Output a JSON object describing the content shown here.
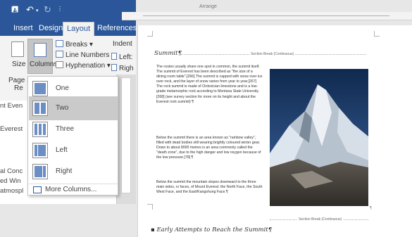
{
  "qat": {
    "save_icon": "save-icon",
    "undo_icon": "undo-icon",
    "redo_icon": "redo-icon",
    "customize_icon": "customize-qat-icon"
  },
  "tabs": [
    {
      "label": "Insert",
      "active": false
    },
    {
      "label": "Design",
      "active": false
    },
    {
      "label": "Layout",
      "active": true
    },
    {
      "label": "References",
      "active": false
    }
  ],
  "ribbon": {
    "breaks": "Breaks",
    "line_numbers": "Line Numbers",
    "hyphenation": "Hyphenation",
    "indent": "Indent",
    "left": "Left:",
    "right": "Righ",
    "size": "Size",
    "columns": "Columns",
    "page_setup_cut": "Page S",
    "page_setup_cut2": "Re"
  },
  "columns_menu": {
    "items": [
      {
        "label": "One"
      },
      {
        "label": "Two",
        "selected": true
      },
      {
        "label": "Three"
      },
      {
        "label": "Left"
      },
      {
        "label": "Right"
      }
    ],
    "more": "More Columns..."
  },
  "background_text": [
    "nt Even",
    "Everest",
    "al Conc",
    "ed Win",
    "atmospl"
  ],
  "document": {
    "toolbar_label": "Arrange",
    "heading1": "Summit¶",
    "section_break": "Section Break (Continuous)",
    "para1": "The routes usually share one spot in common, the summit itself. The summit of Everest has been described as \"the size of a dining room table\".[266] The summit is capped with snow over ice over rock, and the layer of snow varies from year to year.[267] The rock summit is made of Ordovician limestone and is a low-grade metamorphic rock according to Montana State University.[268] (see survey section for more on its height and about the Everest rock summit) ¶",
    "para2": "Below the summit there is an area known as \"rainbow valley\", filled with dead bodies still wearing brightly coloured winter gear. Down to about 8000 metres is an area commonly called the \"death zone\", due to the high danger and low oxygen because of the low pressure.[78] ¶",
    "para3": "Below the summit the mountain slopes downward to the three main sides, or faces, of Mount Everest: the North Face, the South West Face, and the East/Kangshung Face.¶",
    "pilcrow": "¶",
    "heading2": "Early Attempts to Reach the Summit¶"
  },
  "colors": {
    "accent": "#2b579a",
    "menu_selected": "#cacaca"
  }
}
